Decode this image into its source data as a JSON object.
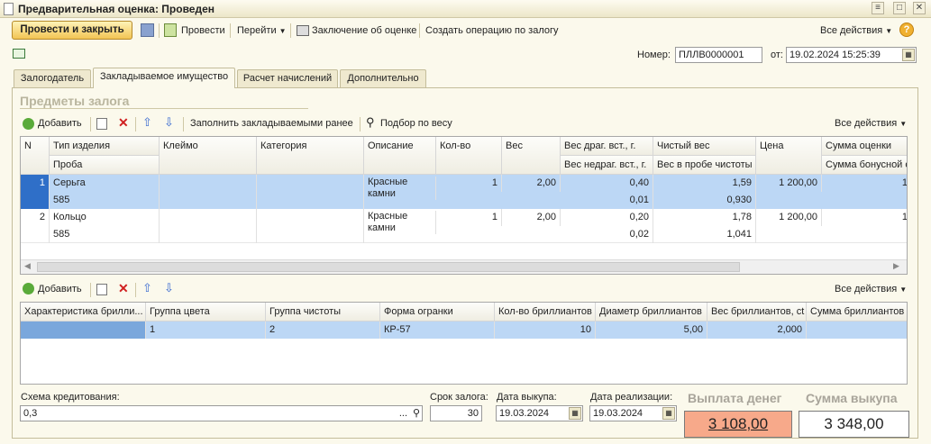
{
  "window": {
    "title": "Предварительная оценка: Проведен"
  },
  "toolbar": {
    "post_close": "Провести и закрыть",
    "post": "Провести",
    "goto": "Перейти",
    "conclusion": "Заключение об оценке",
    "create_pledge": "Создать операцию по залогу",
    "all_actions": "Все действия"
  },
  "header": {
    "number_label": "Номер:",
    "number_value": "ПЛЛВ0000001",
    "from_label": "от:",
    "date_value": "19.02.2024 15:25:39"
  },
  "tabs": [
    "Залогодатель",
    "Закладываемое имущество",
    "Расчет начислений",
    "Дополнительно"
  ],
  "items_section": {
    "title": "Предметы залога",
    "toolbar": {
      "add": "Добавить",
      "fill": "Заполнить закладываемыми ранее",
      "weight": "Подбор по весу",
      "all_actions": "Все действия"
    },
    "headers": {
      "n": "N",
      "type": "Тип изделия",
      "probe": "Проба",
      "mark": "Клеймо",
      "category": "Категория",
      "desc": "Описание",
      "qty": "Кол-во",
      "weight": "Вес",
      "prec": "Вес драг. вст., г.",
      "nonprec": "Вес недраг. вст., г.",
      "net": "Чистый вес",
      "purity": "Вес в пробе чистоты",
      "price": "Цена",
      "sum": "Сумма оценки",
      "bonus": "Сумма бонусной о"
    },
    "rows": [
      {
        "n": "1",
        "type": "Серьга",
        "probe": "585",
        "desc1": "Красные",
        "desc2": "камни",
        "qty": "1",
        "weight": "2,00",
        "prec": "0,40",
        "nonprec": "0,01",
        "net": "1,59",
        "purity": "0,930",
        "price": "1 200,00",
        "sum": "1"
      },
      {
        "n": "2",
        "type": "Кольцо",
        "probe": "585",
        "desc1": "Красные",
        "desc2": "камни",
        "qty": "1",
        "weight": "2,00",
        "prec": "0,20",
        "nonprec": "0,02",
        "net": "1,78",
        "purity": "1,041",
        "price": "1 200,00",
        "sum": "1"
      }
    ]
  },
  "diamonds_section": {
    "toolbar": {
      "add": "Добавить",
      "all_actions": "Все действия"
    },
    "headers": [
      "Характеристика брилли...",
      "Группа цвета",
      "Группа чистоты",
      "Форма огранки",
      "Кол-во бриллиантов",
      "Диаметр бриллиантов",
      "Вес бриллиантов, ct",
      "Сумма бриллиантов"
    ],
    "row": [
      "",
      "1",
      "2",
      "КР-57",
      "10",
      "5,00",
      "2,000",
      ""
    ]
  },
  "footer": {
    "scheme_label": "Схема кредитования:",
    "scheme_value": "0,3",
    "term_label": "Срок залога:",
    "term_value": "30",
    "buyout_label": "Дата выкупа:",
    "buyout_value": "19.03.2024",
    "sale_label": "Дата реализации:",
    "sale_value": "19.03.2024",
    "payout_label": "Выплата денег",
    "payout_value": "3 108,00",
    "redeem_label": "Сумма выкупа",
    "redeem_value": "3 348,00"
  },
  "colors": {
    "selected_row": "#bcd7f5",
    "accent": "#f2c454",
    "payout_bg": "#f7a98a"
  }
}
